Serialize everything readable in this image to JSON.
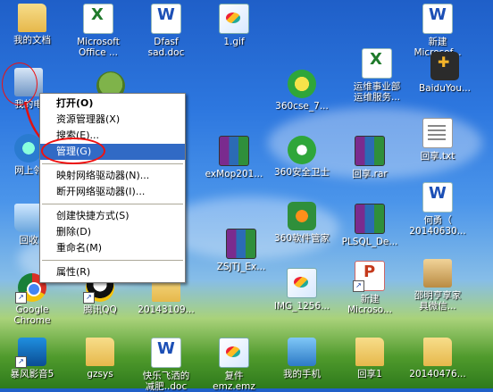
{
  "desktop_icons": [
    {
      "label": "我的文档"
    },
    {
      "label": "Microsoft\nOffice ..."
    },
    {
      "label": "Dfasf\nsad.doc"
    },
    {
      "label": "1.gif"
    },
    {
      "label": "新建\nMicrosof..."
    },
    {
      "label": "运维事业部\n运维服务..."
    },
    {
      "label": "BaiduYou..."
    },
    {
      "label": "我的电"
    },
    {
      "label": "360cse_7..."
    },
    {
      "label": "回享.txt"
    },
    {
      "label": "网上邻"
    },
    {
      "label": "exMop201..."
    },
    {
      "label": "360安全卫士"
    },
    {
      "label": "回享.rar"
    },
    {
      "label": "何勇（\n20140630..."
    },
    {
      "label": "回收"
    },
    {
      "label": "360软件管家"
    },
    {
      "label": "PLSQL_De..."
    },
    {
      "label": "ZSJTJ_Ex..."
    },
    {
      "label": "Google\nChrome"
    },
    {
      "label": "腾讯QQ"
    },
    {
      "label": "20143109..."
    },
    {
      "label": "IMG_1256..."
    },
    {
      "label": "新建\nMicroso..."
    },
    {
      "label": "邵明亨享家\n具微信..."
    },
    {
      "label": "暴风影音5"
    },
    {
      "label": "gzsys"
    },
    {
      "label": "快乐飞洒的\n减肥..doc"
    },
    {
      "label": "复件\nemz.emz"
    },
    {
      "label": "我的手机"
    },
    {
      "label": "回享1"
    },
    {
      "label": "20140476..."
    }
  ],
  "context_menu": {
    "items": [
      {
        "label": "打开(O)"
      },
      {
        "label": "资源管理器(X)"
      },
      {
        "label": "搜索(E)..."
      },
      {
        "label": "管理(G)"
      },
      {
        "label": "映射网络驱动器(N)..."
      },
      {
        "label": "断开网络驱动器(I)..."
      },
      {
        "label": "创建快捷方式(S)"
      },
      {
        "label": "删除(D)"
      },
      {
        "label": "重命名(M)"
      },
      {
        "label": "属性(R)"
      }
    ]
  },
  "colors": {
    "menu_highlight": "#316ac5",
    "annotation_red": "#e11111"
  }
}
